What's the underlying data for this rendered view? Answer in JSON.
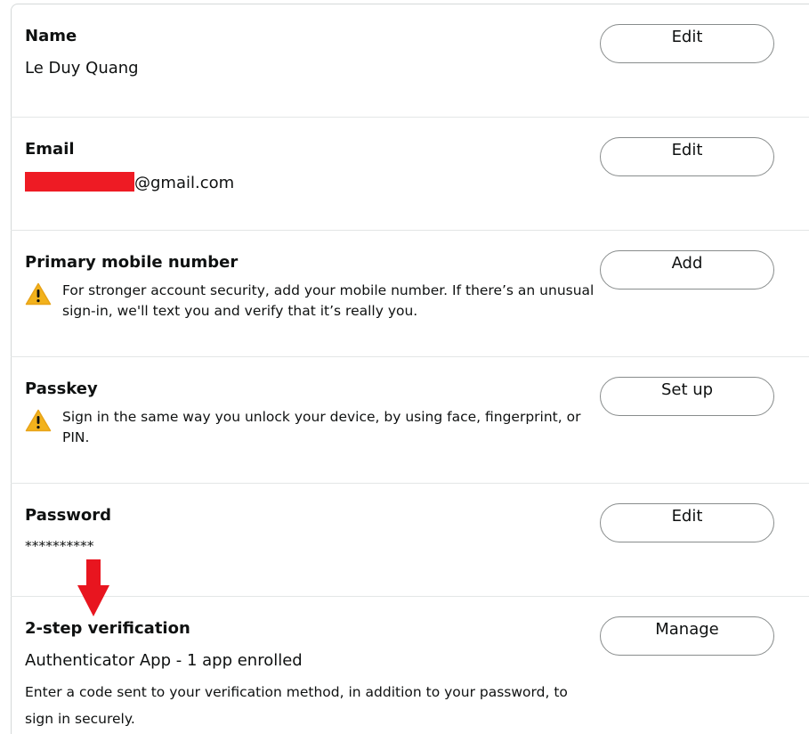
{
  "sections": {
    "name": {
      "title": "Name",
      "value": "Le Duy Quang",
      "button": "Edit"
    },
    "email": {
      "title": "Email",
      "value_suffix": "@gmail.com",
      "button": "Edit"
    },
    "mobile": {
      "title": "Primary mobile number",
      "warning": "For stronger account security, add your mobile number. If there’s an unusual sign-in, we'll text you and verify that it’s really you.",
      "button": "Add"
    },
    "passkey": {
      "title": "Passkey",
      "warning": "Sign in the same way you unlock your device, by using face, fingerprint, or PIN.",
      "button": "Set up"
    },
    "password": {
      "title": "Password",
      "value": "**********",
      "button": "Edit"
    },
    "two_step": {
      "title": "2-step verification",
      "value": "Authenticator App - 1 app enrolled",
      "description": "Enter a code sent to your verification method, in addition to your password, to sign in securely.",
      "button": "Manage"
    }
  },
  "colors": {
    "warning": "#f2b21c",
    "redaction": "#ee1b24",
    "annotation_arrow": "#e8151f"
  },
  "icons": {
    "warning": "warning-triangle-icon",
    "annotation": "down-arrow-annotation"
  }
}
